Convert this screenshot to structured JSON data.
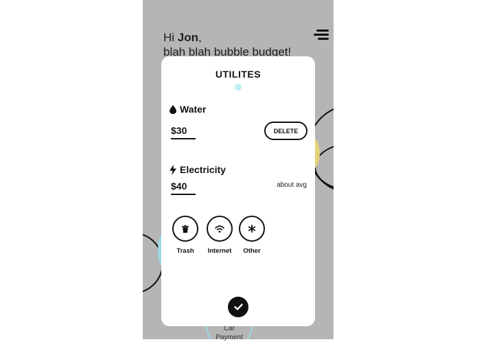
{
  "header": {
    "greeting_prefix": "Hi ",
    "user_name": "Jon",
    "greeting_suffix": ",",
    "tagline": "blah blah bubble budget!"
  },
  "icons": {
    "menu": "menu-icon",
    "water": "droplet-icon",
    "electricity": "lightning-icon",
    "trash": "trash-icon",
    "internet": "wifi-icon",
    "other": "asterisk-icon",
    "confirm": "checkmark-icon"
  },
  "modal": {
    "title": "UTILITES",
    "items": [
      {
        "name": "Water",
        "amount": "$30",
        "action_label": "DELETE"
      },
      {
        "name": "Electricity",
        "amount": "$40",
        "note": "about avg"
      }
    ],
    "add_options": [
      {
        "label": "Trash"
      },
      {
        "label": "Internet"
      },
      {
        "label": "Other"
      }
    ]
  },
  "background": {
    "bubble_label": "Car Payment"
  },
  "colors": {
    "screen_bg": "#b5b5b5",
    "accent_dot": "#bfeef7",
    "bubble_yellow": "#e3d27a",
    "bubble_blue": "#9fd6e6"
  }
}
